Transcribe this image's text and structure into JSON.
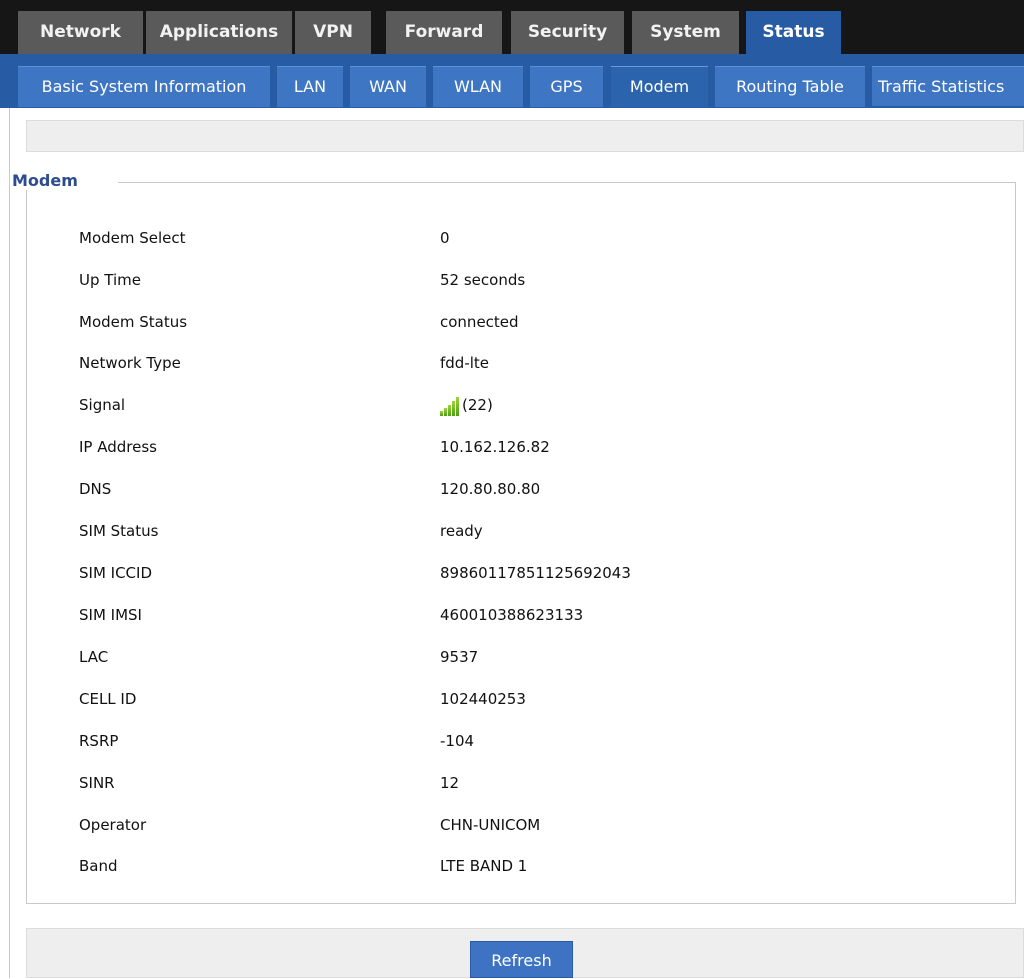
{
  "top_tabs": [
    {
      "label": "Network"
    },
    {
      "label": "Applications"
    },
    {
      "label": "VPN"
    },
    {
      "label": "Forward"
    },
    {
      "label": "Security"
    },
    {
      "label": "System"
    },
    {
      "label": "Status",
      "active": true
    }
  ],
  "sub_tabs": [
    {
      "label": "Basic System Information"
    },
    {
      "label": "LAN"
    },
    {
      "label": "WAN"
    },
    {
      "label": "WLAN"
    },
    {
      "label": "GPS"
    },
    {
      "label": "Modem",
      "active": true
    },
    {
      "label": "Routing Table"
    },
    {
      "label": "Traffic Statistics"
    }
  ],
  "section_title": "Modem",
  "rows": [
    {
      "key": "Modem Select",
      "value": "0"
    },
    {
      "key": "Up Time",
      "value": "52 seconds"
    },
    {
      "key": "Modem Status",
      "value": "connected"
    },
    {
      "key": "Network Type",
      "value": "fdd-lte"
    },
    {
      "key": "Signal",
      "value": "(22)",
      "icon": "signal-bars-icon",
      "signal_level_fraction": 1.0
    },
    {
      "key": "IP Address",
      "value": "10.162.126.82"
    },
    {
      "key": "DNS",
      "value": "120.80.80.80"
    },
    {
      "key": "SIM Status",
      "value": "ready"
    },
    {
      "key": "SIM ICCID",
      "value": "89860117851125692043"
    },
    {
      "key": "SIM IMSI",
      "value": "460010388623133"
    },
    {
      "key": "LAC",
      "value": "9537"
    },
    {
      "key": "CELL ID",
      "value": "102440253"
    },
    {
      "key": "RSRP",
      "value": "-104"
    },
    {
      "key": "SINR",
      "value": "12"
    },
    {
      "key": "Operator",
      "value": "CHN-UNICOM"
    },
    {
      "key": "Band",
      "value": "LTE BAND 1"
    }
  ],
  "refresh_label": "Refresh",
  "colors": {
    "top_bar": "#161616",
    "top_tab": "#5a5a5a",
    "accent_blue": "#275ba4",
    "sub_tab": "#3f76c4",
    "section_title": "#2d4c8f",
    "signal_green": "#6fb82a"
  }
}
